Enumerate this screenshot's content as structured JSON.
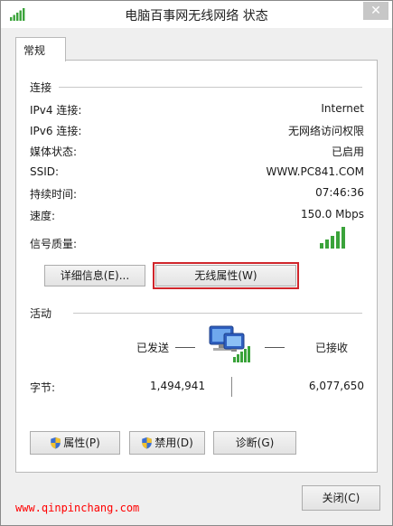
{
  "window": {
    "title": "电脑百事网无线网络 状态"
  },
  "tabs": [
    {
      "label": "常规"
    }
  ],
  "connection": {
    "heading": "连接",
    "rows": [
      {
        "label": "IPv4 连接:",
        "value": "Internet"
      },
      {
        "label": "IPv6 连接:",
        "value": "无网络访问权限"
      },
      {
        "label": "媒体状态:",
        "value": "已启用"
      },
      {
        "label": "SSID:",
        "value": "WWW.PC841.COM"
      },
      {
        "label": "持续时间:",
        "value": "07:46:36"
      },
      {
        "label": "速度:",
        "value": "150.0 Mbps"
      }
    ],
    "signal_label": "信号质量:",
    "signal_bars": 5,
    "details_button": "详细信息(E)...",
    "wireless_props_button": "无线属性(W)"
  },
  "activity": {
    "heading": "活动",
    "sent_label": "已发送",
    "received_label": "已接收",
    "bytes_label": "字节:",
    "bytes_sent": "1,494,941",
    "bytes_received": "6,077,650"
  },
  "actions": {
    "properties_button": "属性(P)",
    "disable_button": "禁用(D)",
    "diagnose_button": "诊断(G)"
  },
  "footer": {
    "close_button": "关闭(C)"
  },
  "watermark": "www.qinpinchang.com",
  "colors": {
    "signal_green": "#3aa33a",
    "highlight_red": "#d0252b"
  },
  "icons": [
    "signal-bars-icon",
    "close-icon",
    "network-computers-icon",
    "shield-icon"
  ]
}
